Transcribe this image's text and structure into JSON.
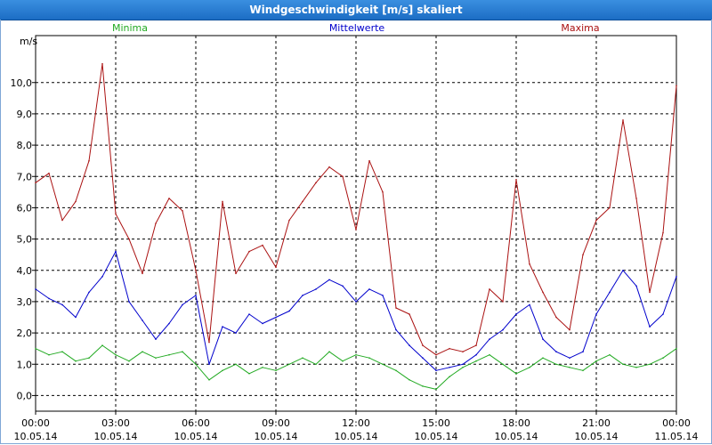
{
  "window": {
    "title": "Windgeschwindigkeit [m/s] skaliert"
  },
  "chart_data": {
    "type": "line",
    "title": "Windgeschwindigkeit [m/s] skaliert",
    "ylabel": "m/s",
    "xlabel": "",
    "ylim": [
      -0.5,
      11.5
    ],
    "xlim": [
      0,
      24
    ],
    "grid": true,
    "legend_position": "top",
    "yticks": [
      0,
      1,
      2,
      3,
      4,
      5,
      6,
      7,
      8,
      9,
      10
    ],
    "ytick_labels": [
      "0,0",
      "1,0",
      "2,0",
      "3,0",
      "4,0",
      "5,0",
      "6,0",
      "7,0",
      "8,0",
      "9,0",
      "10,0"
    ],
    "xticks": [
      {
        "x": 0,
        "time": "00:00",
        "date": "10.05.14"
      },
      {
        "x": 3,
        "time": "03:00",
        "date": "10.05.14"
      },
      {
        "x": 6,
        "time": "06:00",
        "date": "10.05.14"
      },
      {
        "x": 9,
        "time": "09:00",
        "date": "10.05.14"
      },
      {
        "x": 12,
        "time": "12:00",
        "date": "10.05.14"
      },
      {
        "x": 15,
        "time": "15:00",
        "date": "10.05.14"
      },
      {
        "x": 18,
        "time": "18:00",
        "date": "10.05.14"
      },
      {
        "x": 21,
        "time": "21:00",
        "date": "10.05.14"
      },
      {
        "x": 24,
        "time": "00:00",
        "date": "11.05.14"
      }
    ],
    "series": [
      {
        "name": "Minima",
        "color": "#22aa22",
        "x": [
          0,
          0.5,
          1,
          1.5,
          2,
          2.5,
          3,
          3.5,
          4,
          4.5,
          5,
          5.5,
          6,
          6.5,
          7,
          7.5,
          8,
          8.5,
          9,
          9.5,
          10,
          10.5,
          11,
          11.5,
          12,
          12.5,
          13,
          13.5,
          14,
          14.5,
          15,
          15.5,
          16,
          16.5,
          17,
          17.5,
          18,
          18.5,
          19,
          19.5,
          20,
          20.5,
          21,
          21.5,
          22,
          22.5,
          23,
          23.5,
          24
        ],
        "values": [
          1.5,
          1.3,
          1.4,
          1.1,
          1.2,
          1.6,
          1.3,
          1.1,
          1.4,
          1.2,
          1.3,
          1.4,
          1.0,
          0.5,
          0.8,
          1.0,
          0.7,
          0.9,
          0.8,
          1.0,
          1.2,
          1.0,
          1.4,
          1.1,
          1.3,
          1.2,
          1.0,
          0.8,
          0.5,
          0.3,
          0.2,
          0.6,
          0.9,
          1.1,
          1.3,
          1.0,
          0.7,
          0.9,
          1.2,
          1.0,
          0.9,
          0.8,
          1.1,
          1.3,
          1.0,
          0.9,
          1.0,
          1.2,
          1.5
        ]
      },
      {
        "name": "Mittelwerte",
        "color": "#0000cc",
        "x": [
          0,
          0.5,
          1,
          1.5,
          2,
          2.5,
          3,
          3.5,
          4,
          4.5,
          5,
          5.5,
          6,
          6.5,
          7,
          7.5,
          8,
          8.5,
          9,
          9.5,
          10,
          10.5,
          11,
          11.5,
          12,
          12.5,
          13,
          13.5,
          14,
          14.5,
          15,
          15.5,
          16,
          16.5,
          17,
          17.5,
          18,
          18.5,
          19,
          19.5,
          20,
          20.5,
          21,
          21.5,
          22,
          22.5,
          23,
          23.5,
          24
        ],
        "values": [
          3.4,
          3.1,
          2.9,
          2.5,
          3.3,
          3.8,
          4.6,
          3.0,
          2.4,
          1.8,
          2.3,
          2.9,
          3.2,
          1.0,
          2.2,
          2.0,
          2.6,
          2.3,
          2.5,
          2.7,
          3.2,
          3.4,
          3.7,
          3.5,
          3.0,
          3.4,
          3.2,
          2.1,
          1.6,
          1.2,
          0.8,
          0.9,
          1.0,
          1.3,
          1.8,
          2.1,
          2.6,
          2.9,
          1.8,
          1.4,
          1.2,
          1.4,
          2.6,
          3.3,
          4.0,
          3.5,
          2.2,
          2.6,
          3.8
        ]
      },
      {
        "name": "Maxima",
        "color": "#aa1111",
        "x": [
          0,
          0.5,
          1,
          1.5,
          2,
          2.5,
          3,
          3.5,
          4,
          4.5,
          5,
          5.5,
          6,
          6.5,
          7,
          7.5,
          8,
          8.5,
          9,
          9.5,
          10,
          10.5,
          11,
          11.5,
          12,
          12.5,
          13,
          13.5,
          14,
          14.5,
          15,
          15.5,
          16,
          16.5,
          17,
          17.5,
          18,
          18.5,
          19,
          19.5,
          20,
          20.5,
          21,
          21.5,
          22,
          22.5,
          23,
          23.5,
          24
        ],
        "values": [
          6.8,
          7.1,
          5.6,
          6.2,
          7.5,
          10.6,
          5.8,
          5.0,
          3.9,
          5.5,
          6.3,
          5.9,
          4.0,
          1.7,
          6.2,
          3.9,
          4.6,
          4.8,
          4.1,
          5.6,
          6.2,
          6.8,
          7.3,
          7.0,
          5.3,
          7.5,
          6.5,
          2.8,
          2.6,
          1.6,
          1.3,
          1.5,
          1.4,
          1.6,
          3.4,
          3.0,
          6.9,
          4.2,
          3.3,
          2.5,
          2.1,
          4.5,
          5.6,
          6.0,
          8.8,
          6.3,
          3.3,
          5.2,
          9.9
        ]
      }
    ]
  }
}
